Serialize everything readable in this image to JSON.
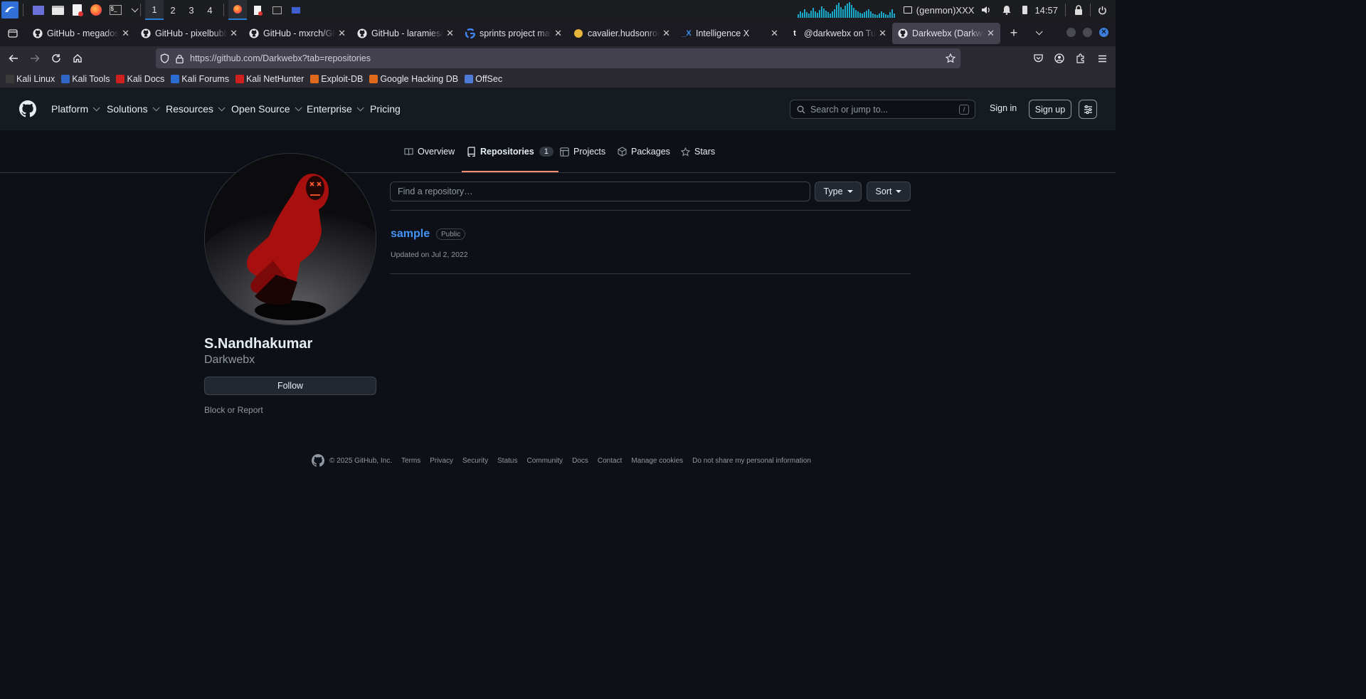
{
  "taskbar": {
    "workspaces": [
      "1",
      "2",
      "3",
      "4"
    ],
    "active_workspace": "1",
    "genmon": "(genmon)XXX",
    "clock": "14:57"
  },
  "tabs": [
    {
      "title": "GitHub - megadose/",
      "icon": "github-icon"
    },
    {
      "title": "GitHub - pixelbubbl",
      "icon": "github-icon"
    },
    {
      "title": "GitHub - mxrch/GH",
      "icon": "github-icon"
    },
    {
      "title": "GitHub - laramies/t",
      "icon": "github-icon"
    },
    {
      "title": "sprints project malw",
      "icon": "google-icon"
    },
    {
      "title": "cavalier.hudsonrock",
      "icon": "hudsonrock-icon"
    },
    {
      "title": "Intelligence X",
      "icon": "intelx-icon"
    },
    {
      "title": "@darkwebx on Tum",
      "icon": "tumblr-icon"
    },
    {
      "title": "Darkwebx (Darkweb",
      "icon": "github-icon",
      "active": true
    }
  ],
  "url": "https://github.com/Darkwebx?tab=repositories",
  "bookmarks": [
    {
      "label": "Kali Linux",
      "color": "#3a3a3a"
    },
    {
      "label": "Kali Tools",
      "color": "#3066c8"
    },
    {
      "label": "Kali Docs",
      "color": "#d02020"
    },
    {
      "label": "Kali Forums",
      "color": "#2a6cd1"
    },
    {
      "label": "Kali NetHunter",
      "color": "#d02020"
    },
    {
      "label": "Exploit-DB",
      "color": "#e06a1b"
    },
    {
      "label": "Google Hacking DB",
      "color": "#e06a1b"
    },
    {
      "label": "OffSec",
      "color": "#4f7bd8"
    }
  ],
  "gh_header": {
    "menu": [
      "Platform",
      "Solutions",
      "Resources",
      "Open Source",
      "Enterprise"
    ],
    "pricing": "Pricing",
    "search_placeholder": "Search or jump to...",
    "search_key": "/",
    "sign_in": "Sign in",
    "sign_up": "Sign up"
  },
  "profile_tabs": {
    "overview": "Overview",
    "repositories": "Repositories",
    "repo_count": "1",
    "projects": "Projects",
    "packages": "Packages",
    "stars": "Stars"
  },
  "profile": {
    "full_name": "S.Nandhakumar",
    "login": "Darkwebx",
    "follow": "Follow",
    "block": "Block or Report"
  },
  "repo_filter": {
    "placeholder": "Find a repository…",
    "type": "Type",
    "sort": "Sort"
  },
  "repos": [
    {
      "name": "sample",
      "visibility": "Public",
      "updated": "Updated on Jul 2, 2022"
    }
  ],
  "footer": {
    "copyright": "© 2025 GitHub, Inc.",
    "links": [
      "Terms",
      "Privacy",
      "Security",
      "Status",
      "Community",
      "Docs",
      "Contact",
      "Manage cookies",
      "Do not share my personal information"
    ]
  },
  "colors": {
    "page_bg": "#0d1117",
    "header_bg": "#161b22",
    "link": "#4493f8",
    "tab_underline": "#fd8c73"
  }
}
